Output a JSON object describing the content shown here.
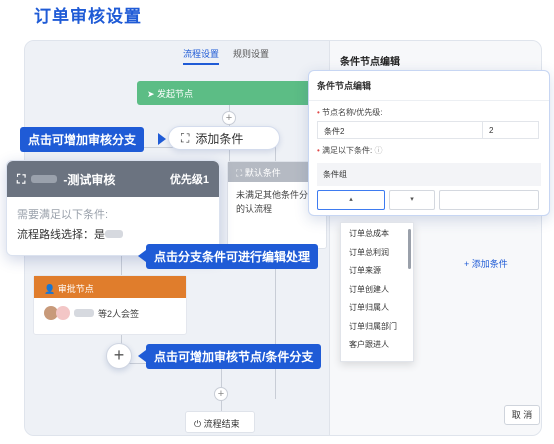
{
  "page_title": "订单审核设置",
  "tabs": [
    {
      "label": "流程设置",
      "active": true
    },
    {
      "label": "规则设置",
      "active": false
    }
  ],
  "flow": {
    "start_node": "发起节点",
    "default_condition": {
      "title": "默认条件",
      "body": "未满足其他条件分支的认流程"
    },
    "approve_node": {
      "title": "审批节点",
      "body": "等2人会签"
    },
    "end_node": "流程结束"
  },
  "condition_card": {
    "title_suffix": "-测试审核",
    "priority": "优先级1",
    "need_text": "需要满足以下条件:",
    "route_text": "流程路线选择：是"
  },
  "add_condition_pill": "添加条件",
  "right_panel": {
    "title": "条件节点编辑",
    "add_condition_link": "+ 添加条件",
    "cancel_label": "取 消"
  },
  "popup": {
    "title": "条件节点编辑",
    "name_label": "节点名称/优先级:",
    "name_value": "条件2",
    "priority_value": "2",
    "conditions_label": "满足以下条件:",
    "group_label": "条件组"
  },
  "dropdown_options": [
    "订单总成本",
    "订单总利润",
    "订单来源",
    "订单创建人",
    "订单归属人",
    "订单归属部门",
    "客户跟进人"
  ],
  "callouts": {
    "add_branch": "点击可增加审核分支",
    "edit_branch": "点击分支条件可进行编辑处理",
    "add_node": "点击可增加审核节点/条件分支"
  },
  "colors": {
    "brand": "#1f5bd6",
    "start": "#5cbd85",
    "approve": "#e07d2c",
    "condition_header": "#6b7380"
  }
}
